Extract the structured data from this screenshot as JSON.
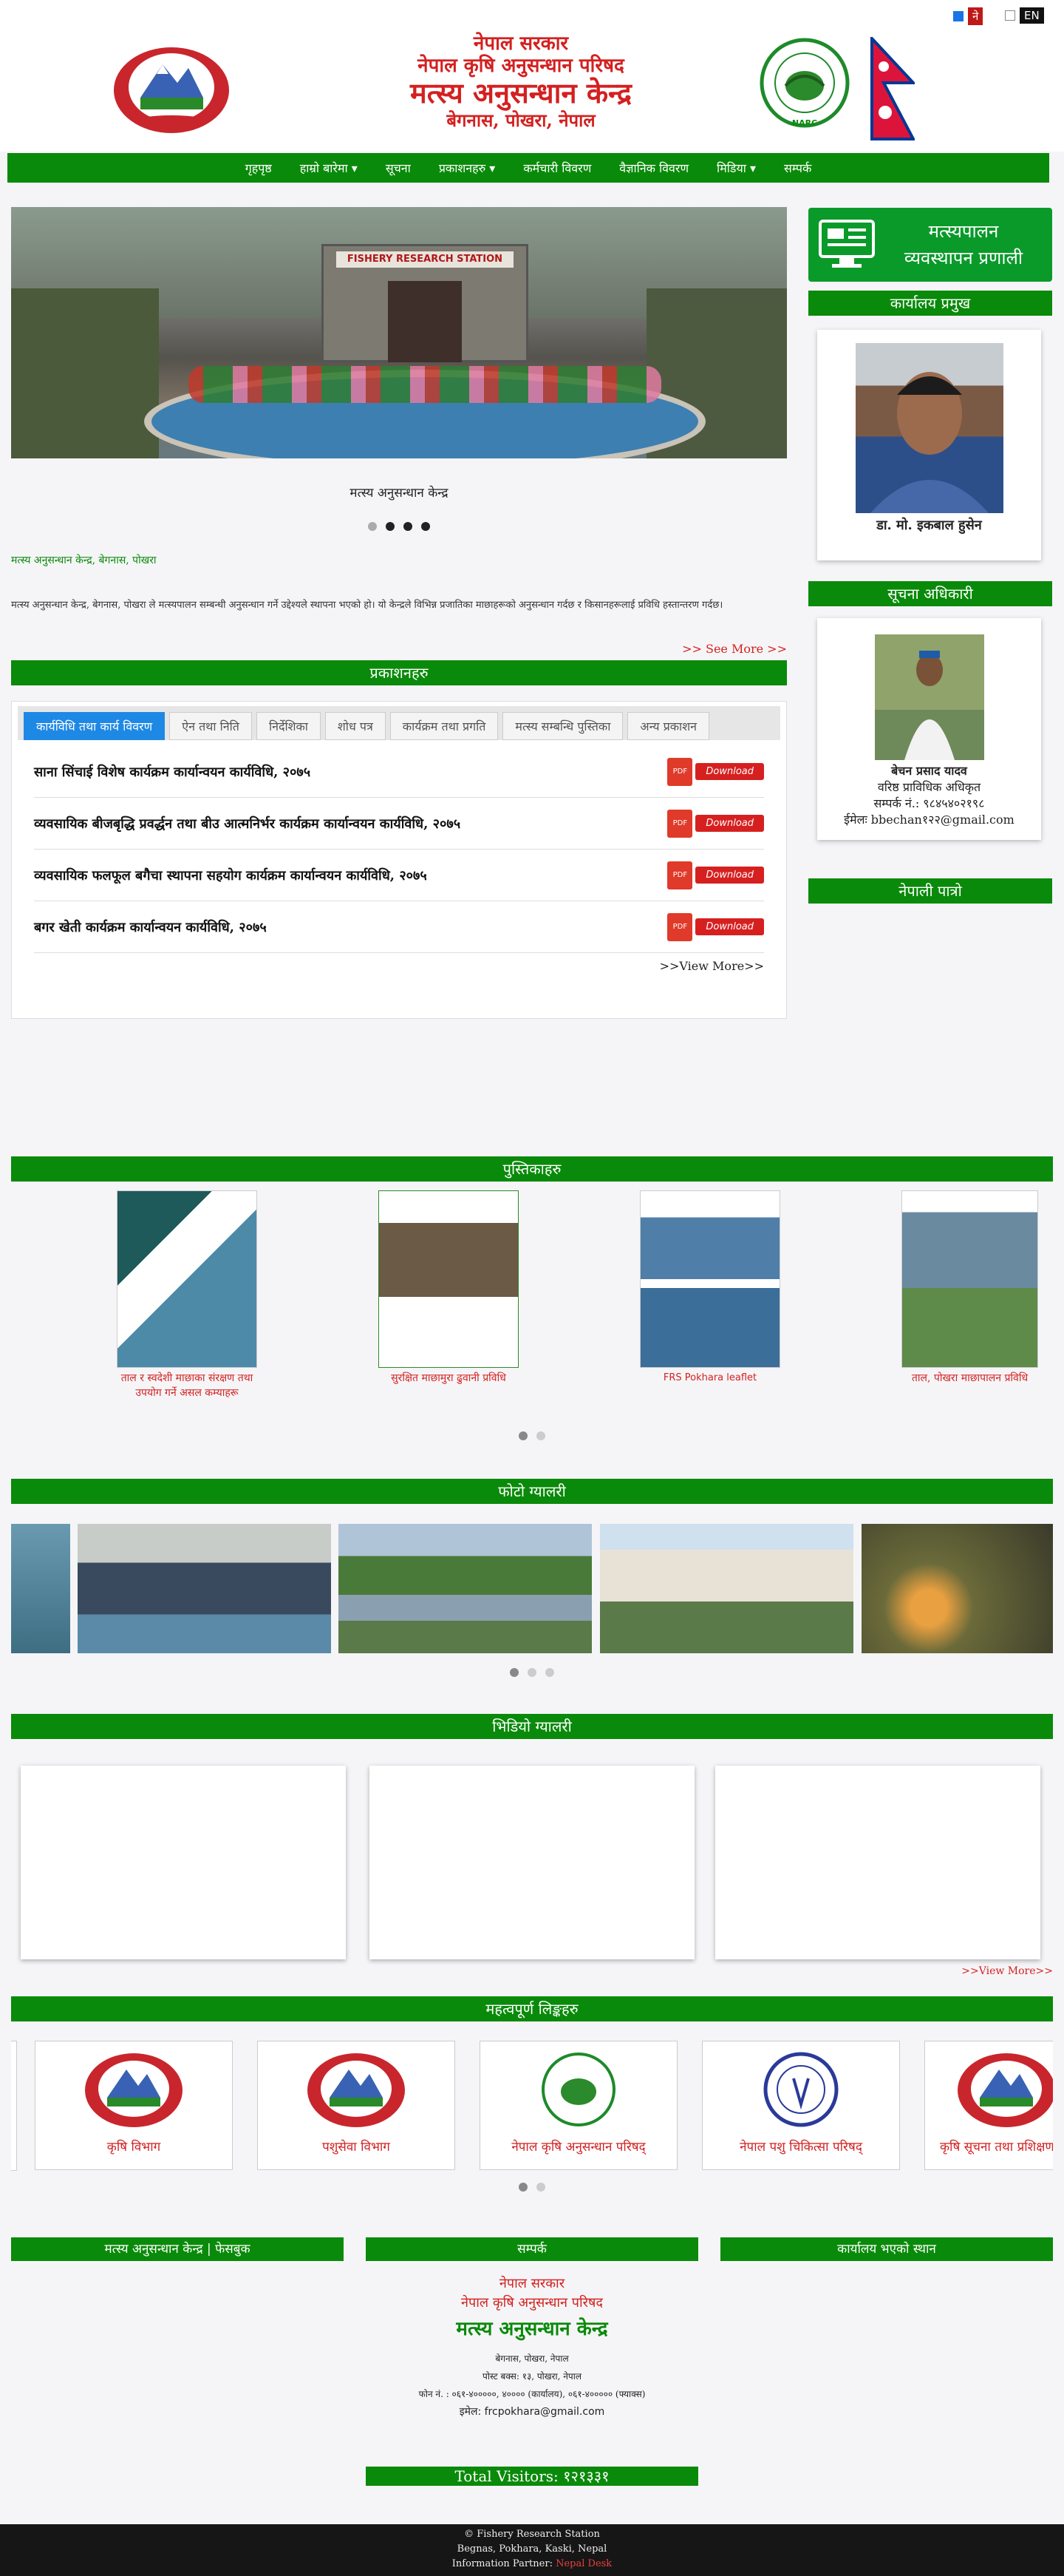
{
  "header": {
    "line1": "नेपाल सरकार",
    "line2": "नेपाल कृषि अनुसन्धान परिषद",
    "line3": "मत्स्य अनुसन्धान केन्द्र",
    "line4": "बेगनास, पोखरा, नेपाल",
    "narc_label": "NARC",
    "lang_ne": "ने",
    "lang_en": "EN"
  },
  "nav": [
    "गृहपृष्ठ",
    "हाम्रो बारेमा ▾",
    "सूचना",
    "प्रकाशनहरु ▾",
    "कर्मचारी विवरण",
    "वैज्ञानिक विवरण",
    "मिडिया ▾",
    "सम्पर्क"
  ],
  "slider": {
    "sign": "FISHERY RESEARCH STATION",
    "caption": "मत्स्य अनुसन्धान केन्द्र"
  },
  "intro": {
    "heading": "मत्स्य अनुसन्धान केन्द्र, बेगनास, पोखरा",
    "body": "मत्स्य अनुसन्धान केन्द्र, बेगनास, पोखरा ले मत्स्यपालन सम्बन्धी अनुसन्धान गर्ने उद्देश्यले स्थापना भएको हो। यो केन्द्रले विभिन्न प्रजातिका माछाहरूको अनुसन्धान गर्दछ र किसानहरूलाई प्रविधि हस्तान्तरण गर्दछ।",
    "see_more": ">> See More >>"
  },
  "publications": {
    "title": "प्रकाशनहरु",
    "tabs": [
      "कार्यविधि तथा कार्य विवरण",
      "ऐन तथा निति",
      "निर्देशिका",
      "शोध पत्र",
      "कार्यक्रम तथा प्रगति",
      "मत्स्य सम्बन्धि पुस्तिका",
      "अन्य प्रकाशन"
    ],
    "docs": [
      "साना सिंचाई विशेष कार्यक्रम कार्यान्वयन कार्यविधि, २०७५",
      "व्यवसायिक बीजबृद्धि प्रवर्द्धन तथा बीउ आत्मनिर्भर कार्यक्रम कार्यान्वयन कार्यविधि, २०७५",
      "व्यवसायिक फलफूल बगैचा स्थापना सहयोग कार्यक्रम कार्यान्वयन कार्यविधि, २०७५",
      "बगर खेती कार्यक्रम कार्यान्वयन कार्यविधि, २०७५"
    ],
    "pdf": "PDF",
    "download": "Download",
    "view_more": ">>View More>>"
  },
  "right": {
    "mgmt_line1": "मत्स्यपालन",
    "mgmt_line2": "व्यवस्थापन प्रणाली",
    "chief_title": "कार्यालय प्रमुख",
    "chief_name": "डा. मो. इकबाल हुसेन",
    "info_title": "सूचना अधिकारी",
    "info_name": "बेचन प्रसाद यादव",
    "info_role": "वरिष्ठ प्राविधिक अधिकृत",
    "info_phone": "सम्पर्क नं.: ९८४५४०२१९८",
    "info_email": "ईमेलः bbechan१२२@gmail.com",
    "patro_title": "नेपाली पात्रो"
  },
  "booklets": {
    "title": "पुस्तिकाहरु",
    "items": [
      "ताल र स्वदेशी माछाका संरक्षण तथा उपयोग गर्ने असल कम्याहरू",
      "सुरक्षित माछामुरा ढुवानी प्रविधि",
      "FRS Pokhara leaflet",
      "ताल, पोखरा माछापालन प्रविधि"
    ]
  },
  "gallery": {
    "title": "फोटो ग्यालरी"
  },
  "videos": {
    "title": "भिडियो ग्यालरी",
    "view_more": ">>View More>>"
  },
  "links": {
    "title": "महत्वपूर्ण लिङ्कहरु",
    "items": [
      "कृषि विभाग",
      "पशुसेवा विभाग",
      "नेपाल कृषि अनुसन्धान परिषद्",
      "नेपाल पशु चिकित्सा परिषद्",
      "कृषि सूचना तथा प्रशिक्षण"
    ]
  },
  "bottom": {
    "fb_title": "मत्स्य अनुसन्धान केन्द्र | फेसबुक",
    "contact_title": "सम्पर्क",
    "location_title": "कार्यालय भएको स्थान",
    "contact_l1": "नेपाल सरकार",
    "contact_l2": "नेपाल कृषि अनुसन्धान परिषद",
    "contact_l3": "मत्स्य अनुसन्धान केन्द्र",
    "addr": "बेगनास, पोखरा, नेपाल",
    "addr2": "पोस्ट बक्स: १३, पोखरा, नेपाल",
    "phone": "फोन नं. : ०६१-४०००००, ४०००० (कार्यालय), ०६१-४००००० (फ्याक्स)",
    "email": "इमेल: frcpokhara@gmail.com",
    "visitors": "Total Visitors: १२१३३१"
  },
  "footer": {
    "l1": "© Fishery Research Station",
    "l2": "Begnas, Pokhara, Kaski, Nepal",
    "l3": "Information Partner:",
    "partner": "Nepal Desk"
  }
}
